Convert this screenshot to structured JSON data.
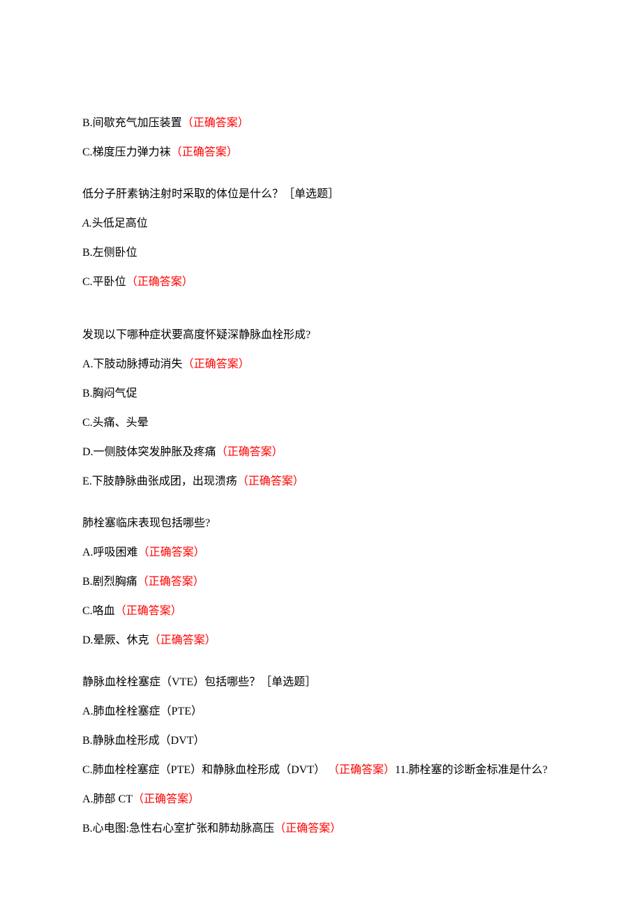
{
  "correct_label": "（正确答案）",
  "q1": {
    "optB": "B.间歇充气加压装置",
    "optC": "C.梯度压力弹力袜"
  },
  "q2": {
    "stem": "低分子肝素钠注射时采取的体位是什么？［单选题］",
    "optA_prefix": "A.",
    "optA_text": "头低足高位",
    "optB": "B.左侧卧位",
    "optC": "C.平卧位"
  },
  "q3": {
    "stem": "发现以下哪种症状要高度怀疑深静脉血栓形成?",
    "optA": "A.下肢动脉搏动消失",
    "optB": "B.胸闷气促",
    "optC": "C.头痛、头晕",
    "optD": "D.一侧肢体突发肿胀及疼痛",
    "optE": "E.下肢静脉曲张成团，出现溃疡"
  },
  "q4": {
    "stem": "肺栓塞临床表现包括哪些?",
    "optA": "A.呼吸困难",
    "optB": "B.剧烈胸痛",
    "optC": "C.咯血",
    "optD": "D.晕厥、休克"
  },
  "q5": {
    "stem": "静脉血栓栓塞症（VTE）包括哪些？［单选题］",
    "optA": "A.肺血栓栓塞症（PTE）",
    "optB": "B.静脉血栓形成（DVT）",
    "optC": "C.肺血栓栓塞症（PTE）和静脉血栓形成（DVT）",
    "trail": "11.肺栓塞的诊断金标准是什么?"
  },
  "q6": {
    "optA": "A.肺部 CT",
    "optB": "B.心电图:急性右心室扩张和肺劫脉高压"
  }
}
